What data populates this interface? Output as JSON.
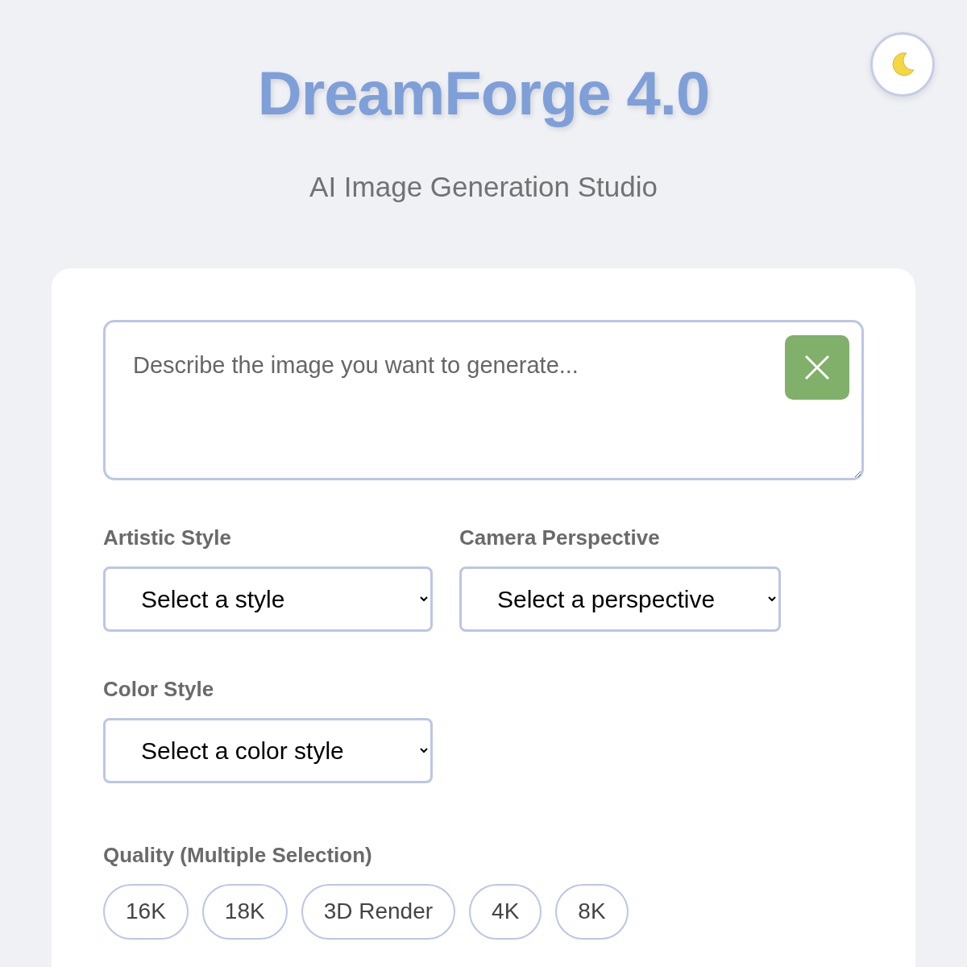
{
  "header": {
    "title": "DreamForge 4.0",
    "subtitle": "AI Image Generation Studio"
  },
  "prompt": {
    "placeholder": "Describe the image you want to generate..."
  },
  "selects": [
    {
      "label": "Artistic Style",
      "value": "Select a style"
    },
    {
      "label": "Camera Perspective",
      "value": "Select a perspective"
    },
    {
      "label": "Color Style",
      "value": "Select a color style"
    }
  ],
  "quality": {
    "label": "Quality (Multiple Selection)",
    "chips": [
      {
        "label": "16K",
        "selected": false
      },
      {
        "label": "18K",
        "selected": false
      },
      {
        "label": "3D Render",
        "selected": false
      },
      {
        "label": "4K",
        "selected": false
      },
      {
        "label": "8K",
        "selected": false
      }
    ]
  }
}
